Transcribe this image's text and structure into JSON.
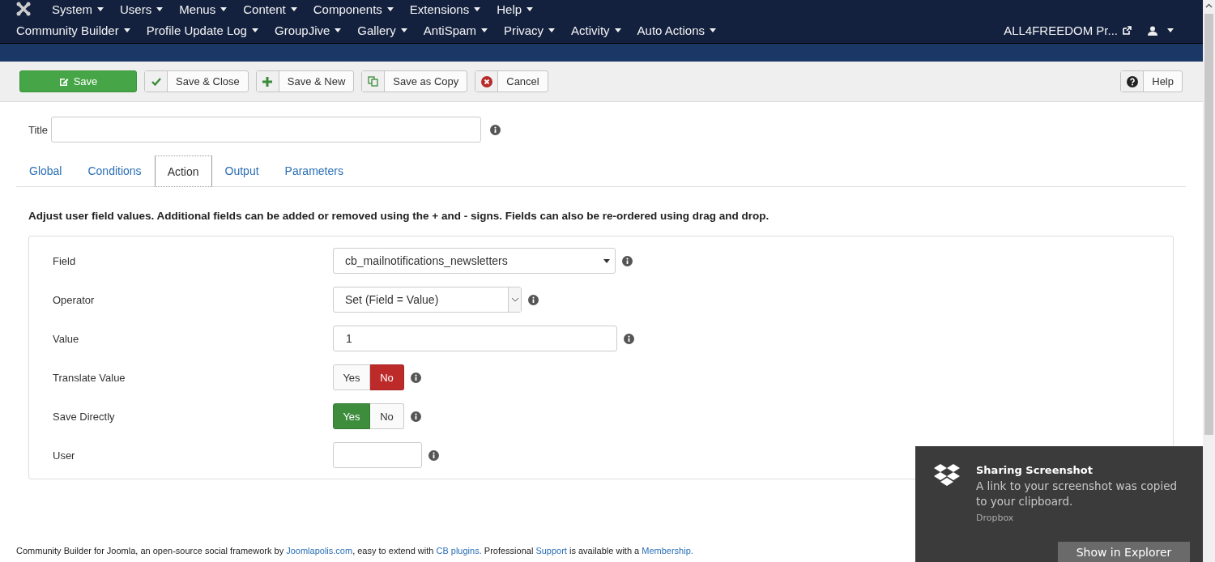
{
  "menu_bar": {
    "primary": [
      {
        "label": "System"
      },
      {
        "label": "Users"
      },
      {
        "label": "Menus"
      },
      {
        "label": "Content"
      },
      {
        "label": "Components"
      },
      {
        "label": "Extensions"
      },
      {
        "label": "Help"
      }
    ],
    "secondary": [
      {
        "label": "Community Builder"
      },
      {
        "label": "Profile Update Log"
      },
      {
        "label": "GroupJive"
      },
      {
        "label": "Gallery"
      },
      {
        "label": "AntiSpam"
      },
      {
        "label": "Privacy"
      },
      {
        "label": "Activity"
      },
      {
        "label": "Auto Actions"
      }
    ],
    "site_link": "ALL4FREEDOM Pr..."
  },
  "toolbar": {
    "buttons": [
      {
        "label": "Save",
        "kind": "primary"
      },
      {
        "label": "Save & Close",
        "kind": "check"
      },
      {
        "label": "Save & New",
        "kind": "plus"
      },
      {
        "label": "Save as Copy",
        "kind": "copy"
      },
      {
        "label": "Cancel",
        "kind": "cancel"
      }
    ],
    "help": "Help"
  },
  "title_field": {
    "label": "Title"
  },
  "tabs": [
    {
      "label": "Global",
      "selected": false
    },
    {
      "label": "Conditions",
      "selected": false
    },
    {
      "label": "Action",
      "selected": true
    },
    {
      "label": "Output",
      "selected": false
    },
    {
      "label": "Parameters",
      "selected": false
    }
  ],
  "description": "Adjust user field values. Additional fields can be added or removed using the + and - signs. Fields can also be re-ordered using drag and drop.",
  "fields": [
    {
      "label": "Field",
      "kind": "dropdown",
      "value": "cb_mailnotifications_newsletters"
    },
    {
      "label": "Operator",
      "kind": "select",
      "value": "Set (Field = Value)"
    },
    {
      "label": "Value",
      "kind": "text",
      "value": "1"
    },
    {
      "label": "Translate Value",
      "kind": "toggle",
      "options": [
        {
          "label": "Yes",
          "selected": false
        },
        {
          "label": "No",
          "selected": true
        }
      ]
    },
    {
      "label": "Save Directly",
      "kind": "toggle",
      "options": [
        {
          "label": "Yes",
          "selected": true
        },
        {
          "label": "No",
          "selected": false
        }
      ]
    },
    {
      "label": "User",
      "kind": "short-text"
    }
  ],
  "footer": [
    {
      "text": "Community Builder for Joomla, an open-source social framework by ",
      "kind": "text"
    },
    {
      "text": "Joomlapolis.com",
      "kind": "link"
    },
    {
      "text": ", easy to extend with ",
      "kind": "text"
    },
    {
      "text": "CB plugins.",
      "kind": "link"
    },
    {
      "text": " Professional ",
      "kind": "text"
    },
    {
      "text": "Support",
      "kind": "link"
    },
    {
      "text": " is available with a ",
      "kind": "text"
    },
    {
      "text": "Membership.",
      "kind": "link"
    }
  ],
  "notification": {
    "title": "Sharing Screenshot",
    "message": "A link to your screenshot was copied to your clipboard.",
    "source": "Dropbox",
    "action": "Show in Explorer"
  }
}
